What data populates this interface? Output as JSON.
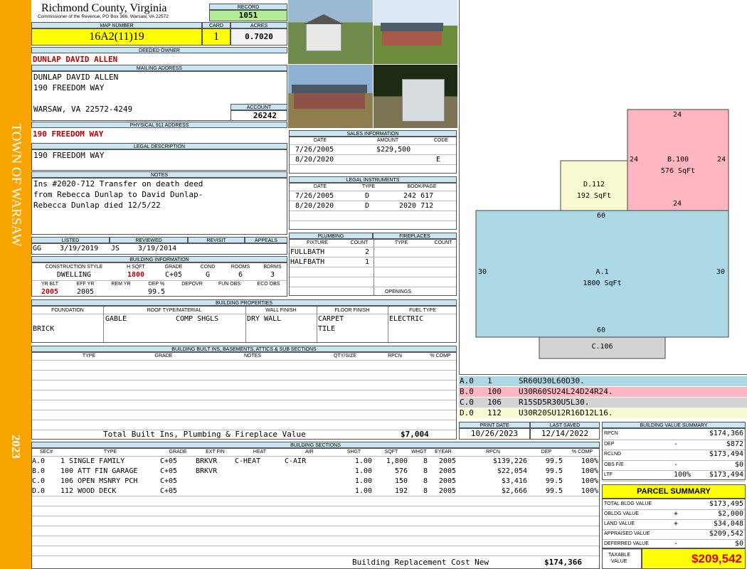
{
  "sidebar": {
    "town": "TOWN OF WARSAW",
    "year": "2023"
  },
  "header": {
    "title": "Richmond County, Virginia",
    "subtitle": "Commissioner of the Revenue, PO Box 366, Warsaw, VA 22572",
    "record_label": "RECORD",
    "record_value": "1051"
  },
  "parcel": {
    "map_label": "MAP NUMBER",
    "map_value": "16A2(11)19",
    "card_label": "CARD",
    "card_value": "1",
    "acres_label": "ACRES",
    "acres_value": "0.7020"
  },
  "owner": {
    "deeded_label": "DEEDED OWNER",
    "deeded_value": "DUNLAP DAVID ALLEN",
    "mailing_label": "MAILING ADDRESS",
    "mail_line1": "DUNLAP DAVID ALLEN",
    "mail_line2": "190 FREEDOM WAY",
    "mail_line3": "",
    "mail_line4": "WARSAW, VA 22572-4249",
    "account_label": "ACCOUNT",
    "account_value": "26242",
    "physical_label": "PHYSICAL 911 ADDRESS",
    "physical_value": "190 FREEDOM WAY"
  },
  "legal": {
    "label": "LEGAL DESCRIPTION",
    "value": "190 FREEDOM WAY"
  },
  "notes": {
    "label": "NOTES",
    "line1": "Ins #2020-712 Transfer on death deed",
    "line2": "from Rebecca Dunlap to David Dunlap-",
    "line3": "Rebecca Dunlap died 12/5/22"
  },
  "sales": {
    "label": "SALES INFORMATION",
    "headers": [
      "DATE",
      "AMOUNT",
      "CODE"
    ],
    "rows": [
      {
        "date": "7/26/2005",
        "amount": "$229,500",
        "code": ""
      },
      {
        "date": "8/20/2020",
        "amount": "",
        "code": "E"
      }
    ]
  },
  "legal_instruments": {
    "label": "LEGAL INSTRUMENTS",
    "headers": [
      "DATE",
      "TYPE",
      "BOOK/PAGE"
    ],
    "rows": [
      {
        "date": "7/26/2005",
        "type": "D",
        "book": "242 617"
      },
      {
        "date": "8/20/2020",
        "type": "D",
        "book": "2020 712"
      }
    ]
  },
  "listed": {
    "listed_label": "LISTED",
    "reviewed_label": "REVIEWED",
    "revisit_label": "REVISIT",
    "appeals_label": "APPEALS",
    "listed_by": "GG",
    "listed_date": "3/19/2019",
    "reviewed_by": "JS",
    "reviewed_date": "3/19/2014"
  },
  "building_info": {
    "label": "BUILDING INFORMATION",
    "h1": [
      "CONSTRUCTION STYLE",
      "H SQFT",
      "GRADE",
      "COND",
      "ROOMS",
      "BDRMS"
    ],
    "v1": [
      "DWELLING",
      "1800",
      "C+05",
      "G",
      "6",
      "3"
    ],
    "h2": [
      "YR BLT",
      "EFF YR",
      "REM YR",
      "DEP %",
      "DEPOVR",
      "FUN OBS",
      "ECO OBS"
    ],
    "v2": [
      "2005",
      "2005",
      "",
      "99.5",
      "",
      "",
      ""
    ]
  },
  "plumbing": {
    "label": "PLUMBING",
    "fireplaces_label": "FIREPLACES",
    "h": [
      "FIXTURE",
      "COUNT",
      "TYPE",
      "COUNT"
    ],
    "rows": [
      {
        "fixture": "FULLBATH",
        "count": "2"
      },
      {
        "fixture": "HALFBATH",
        "count": "1"
      }
    ],
    "openings_label": "OPENINGS"
  },
  "properties": {
    "label": "BUILDING PROPERTIES",
    "h": [
      "FOUNDATION",
      "ROOF TYPE/MATERIAL",
      "WALL FINISH",
      "FLOOR FINISH",
      "FUEL TYPE"
    ],
    "foundation": "BRICK",
    "roof_type": "GABLE",
    "roof_material": "COMP SHGLS",
    "wall": "DRY WALL",
    "floor1": "CARPET",
    "floor2": "TILE",
    "fuel": "ELECTRIC"
  },
  "builtins": {
    "label": "BUILDING BUILT INS, BASEMENTS, ATTICS & SUB SECTIONS",
    "h": [
      "TYPE",
      "GRADE",
      "NOTES",
      "QTY/SIZE",
      "RPCN",
      "% COMP"
    ],
    "total_label": "Total Built Ins, Plumbing & Fireplace Value",
    "total_value": "$7,004"
  },
  "sections": {
    "label": "BUILDING SECTIONS",
    "h": [
      "SEC#",
      "TYPE",
      "GRADE",
      "EXT FIN",
      "HEAT",
      "AIR",
      "SHGT",
      "SQFT",
      "WHGT",
      "EYEAR",
      "RPCN",
      "DEP",
      "% COMP"
    ],
    "rows": [
      {
        "sec": "A.0",
        "type": "1 SINGLE FAMILY",
        "grade": "C+05",
        "ext": "BRKVR",
        "heat": "C-HEAT",
        "air": "C-AIR",
        "shgt": "1.00",
        "sqft": "1,800",
        "whgt": "8",
        "eyear": "2005",
        "rpcn": "$139,226",
        "dep": "99.5",
        "comp": "100%"
      },
      {
        "sec": "B.0",
        "type": "100 ATT FIN GARAGE",
        "grade": "C+05",
        "ext": "BRKVR",
        "heat": "",
        "air": "",
        "shgt": "1.00",
        "sqft": "576",
        "whgt": "8",
        "eyear": "2005",
        "rpcn": "$22,054",
        "dep": "99.5",
        "comp": "100%"
      },
      {
        "sec": "C.0",
        "type": "106 OPEN MSNRY PCH",
        "grade": "C+05",
        "ext": "",
        "heat": "",
        "air": "",
        "shgt": "1.00",
        "sqft": "150",
        "whgt": "8",
        "eyear": "2005",
        "rpcn": "$3,416",
        "dep": "99.5",
        "comp": "100%"
      },
      {
        "sec": "D.0",
        "type": "112 WOOD DECK",
        "grade": "C+05",
        "ext": "",
        "heat": "",
        "air": "",
        "shgt": "1.00",
        "sqft": "192",
        "whgt": "8",
        "eyear": "2005",
        "rpcn": "$2,666",
        "dep": "99.5",
        "comp": "100%"
      }
    ],
    "replacement_label": "Building Replacement Cost New",
    "replacement_value": "$174,366"
  },
  "sketch": {
    "d_name": "D.112",
    "d_area": "192 SqFt",
    "b_name": "B.100",
    "b_area": "576 SqFt",
    "a_name": "A.1",
    "a_area": "1800 SqFt",
    "c_name": "C.106",
    "dim24": "24",
    "dim60": "60",
    "dim30": "30"
  },
  "sketch_legend": [
    {
      "code": "A.0",
      "num": "1",
      "desc": "SR60U30L60D30.",
      "color": "#add8e6"
    },
    {
      "code": "B.0",
      "num": "100",
      "desc": "U30R60SU24L24D24R24.",
      "color": "#ffb6c1"
    },
    {
      "code": "C.0",
      "num": "106",
      "desc": "R15SD5R30U5L30.",
      "color": "#d3d3d3"
    },
    {
      "code": "D.0",
      "num": "112",
      "desc": "U30R20SU12R16D12L16.",
      "color": "#fafad2"
    }
  ],
  "dates": {
    "print_label": "PRINT DATE",
    "print_value": "10/26/2023",
    "saved_label": "LAST SAVED",
    "saved_value": "12/14/2022"
  },
  "bvs": {
    "label": "BUILDING VALUE SUMMARY",
    "rows": [
      {
        "l": "RPCN",
        "s": "",
        "v": "$174,366"
      },
      {
        "l": "DEP",
        "s": "-",
        "v": "$872"
      },
      {
        "l": "RCLND",
        "s": "",
        "v": "$173,494"
      },
      {
        "l": "OBS F/E",
        "s": "-",
        "v": "$0"
      },
      {
        "l": "LTF",
        "s": "100%",
        "v": "$173,494"
      }
    ]
  },
  "summary": {
    "label": "PARCEL SUMMARY",
    "rows": [
      {
        "l": "TOTAL BLDG VALUE",
        "s": "",
        "v": "$173,495"
      },
      {
        "l": "OBLDG VALUE",
        "s": "+",
        "v": "$2,000"
      },
      {
        "l": "LAND VALUE",
        "s": "+",
        "v": "$34,048"
      },
      {
        "l": "APPRAISED VALUE",
        "s": "",
        "v": "$209,542"
      },
      {
        "l": "DEFERRED VALUE",
        "s": "-",
        "v": "$0"
      }
    ],
    "taxable_label1": "TAXABLE",
    "taxable_label2": "VALUE",
    "taxable_value": "$209,542"
  }
}
